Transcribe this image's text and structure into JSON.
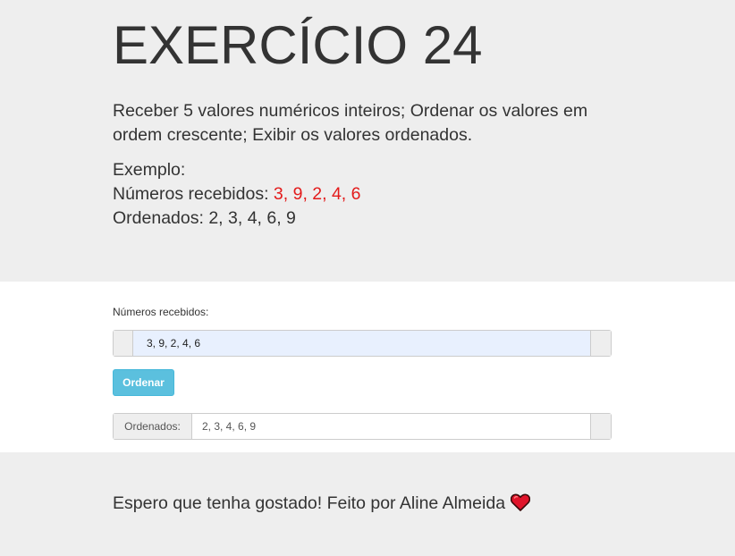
{
  "header": {
    "title": "EXERCÍCIO 24",
    "description": "Receber 5 valores numéricos inteiros; Ordenar os valores em ordem crescente; Exibir os valores ordenados.",
    "example_label": "Exemplo:",
    "example_received_label": "Números recebidos: ",
    "example_received_value": "3, 9, 2, 4, 6",
    "example_sorted_label": "Ordenados: ",
    "example_sorted_value": "2, 3, 4, 6, 9"
  },
  "form": {
    "input_label": "Números recebidos:",
    "input_value": "3, 9, 2, 4, 6",
    "button_label": "Ordenar",
    "output_label": "Ordenados:",
    "output_value": "2, 3, 4, 6, 9"
  },
  "footer": {
    "text": "Espero que tenha gostado! Feito por Aline Almeida",
    "icon": "heart-icon"
  },
  "colors": {
    "accent_red": "#e31b1b",
    "button": "#5bc0de",
    "autofill_bg": "#e8f0fe",
    "jumbotron_bg": "#eeeeee"
  }
}
